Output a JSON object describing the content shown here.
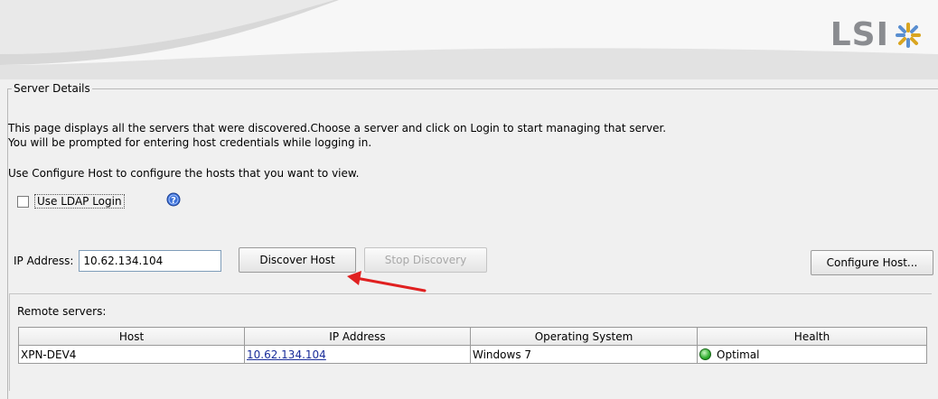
{
  "brand": {
    "logo_text": "LSI"
  },
  "server_details": {
    "legend": "Server Details",
    "description_line1": "This page displays all the servers that were discovered.Choose a server and click on Login to start managing that server.",
    "description_line2": "You will be prompted for entering host credentials while logging in.",
    "configure_hint": "Use Configure Host to configure the hosts that you want to view.",
    "ldap_label": "Use LDAP Login",
    "ldap_checked": false
  },
  "discovery": {
    "ip_label": "IP Address:",
    "ip_value": "10.62.134.104",
    "discover_button": "Discover Host",
    "stop_button": "Stop Discovery",
    "configure_button": "Configure Host..."
  },
  "remote_servers": {
    "label": "Remote servers:",
    "columns": [
      "Host",
      "IP Address",
      "Operating System",
      "Health"
    ],
    "rows": [
      {
        "host": "XPN-DEV4",
        "ip": "10.62.134.104",
        "os": "Windows 7",
        "health": "Optimal"
      }
    ]
  },
  "colors": {
    "link": "#1a2d9a",
    "health_ok": "#2fae2f",
    "arrow": "#e02020"
  }
}
